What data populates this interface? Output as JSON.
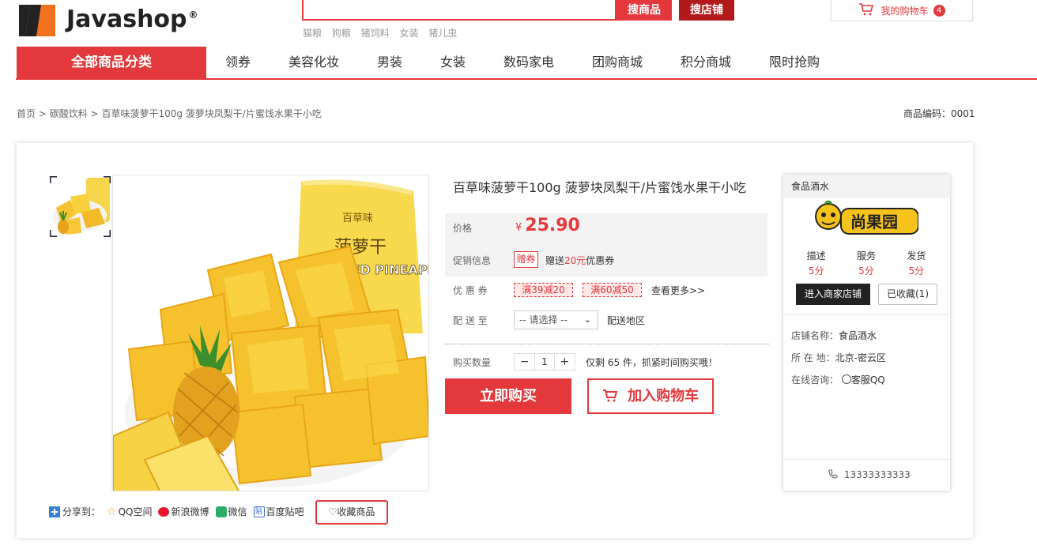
{
  "header": {
    "logo_text": "Javashop",
    "logo_reg": "®",
    "search_goods_label": "搜商品",
    "search_shop_label": "搜店铺",
    "hot_words": [
      "猫粮",
      "狗粮",
      "猪饲料",
      "女装",
      "猪儿虫"
    ],
    "cart_label": "我的购物车",
    "cart_count": "4"
  },
  "nav": {
    "all_label": "全部商品分类",
    "items": [
      "领券",
      "美容化妆",
      "男装",
      "女装",
      "数码家电",
      "团购商城",
      "积分商城",
      "限时抢购"
    ]
  },
  "breadcrumb": {
    "home": "首页",
    "sep1": ">",
    "category": "碳酸饮料",
    "sep2": ">",
    "current": "百草味菠萝干100g 菠萝块凤梨干/片蜜饯水果干小吃"
  },
  "goods_code": "商品编码：0001",
  "product": {
    "title": "百草味菠萝干100g 菠萝块凤梨干/片蜜饯水果干小吃",
    "price_label": "价格",
    "currency": "¥",
    "price": "25.90",
    "promo_label": "促销信息",
    "promo_tag": "赠券",
    "promo_text_a": "赠送",
    "promo_amount": "20元",
    "promo_text_b": "优惠券",
    "coupon_label": "优 惠 券",
    "coupons": [
      "满39减20",
      "满60减50"
    ],
    "coupon_more": "查看更多>>",
    "ship_label": "配 送 至",
    "ship_select": "-- 请选择 --",
    "ship_area": "配送地区",
    "qty_label": "购买数量",
    "qty_minus": "−",
    "qty_value": "1",
    "qty_plus": "+",
    "stock_text": "仅剩 65 件，抓紧时间购买哦！",
    "buy_now": "立即购买",
    "add_cart": "加入购物车",
    "package_brand": "百草味",
    "package_name": "菠萝干",
    "package_en": "DRIED PINEAPPLE"
  },
  "share": {
    "label": "分享到：",
    "items": [
      "QQ空间",
      "新浪微博",
      "微信",
      "百度贴吧"
    ],
    "favorite": "收藏商品"
  },
  "store": {
    "name": "食品酒水",
    "logo_text": "尚果园",
    "scores": [
      {
        "label": "描述",
        "value": "5分"
      },
      {
        "label": "服务",
        "value": "5分"
      },
      {
        "label": "发货",
        "value": "5分"
      }
    ],
    "enter": "进入商家店铺",
    "collected": "已收藏(1)",
    "shop_name_label": "店铺名称：",
    "shop_name": "食品酒水",
    "location_label": "所 在 地：",
    "location": "北京-密云区",
    "consult_label": "在线咨询：",
    "consult": "客服QQ",
    "phone": "13333333333"
  },
  "colors": {
    "accent": "#e4393c",
    "dark_red": "#b1191a"
  }
}
